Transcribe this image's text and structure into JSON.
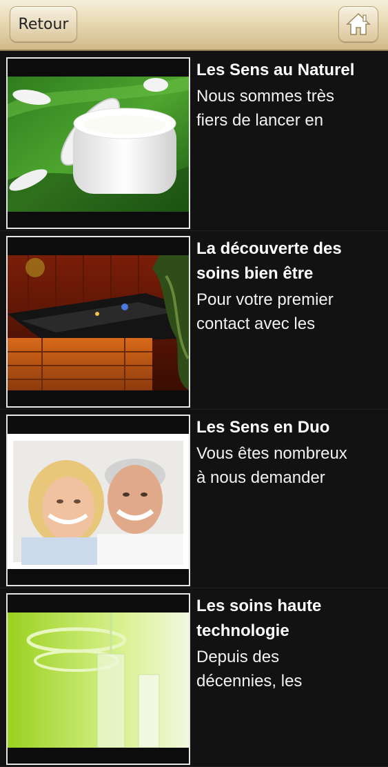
{
  "header": {
    "back_label": "Retour",
    "home_icon": "home-icon"
  },
  "items": [
    {
      "title": "Les Sens au Naturel",
      "desc_line1": "Nous sommes très",
      "desc_line2": "fiers de lancer en",
      "image": "cream-jar-on-leaf"
    },
    {
      "title": "La découverte des",
      "title_line2": "soins bien être",
      "desc_line1": "Pour votre premier",
      "desc_line2": "contact avec les",
      "image": "hot-tub-spa"
    },
    {
      "title": "Les Sens en Duo",
      "desc_line1": "Vous êtes nombreux",
      "desc_line2": "à nous demander",
      "image": "smiling-couple"
    },
    {
      "title": "Les soins haute",
      "title_line2": "technologie",
      "desc_line1": "Depuis des",
      "desc_line2": "décennies, les",
      "image": "lab-glassware"
    }
  ]
}
